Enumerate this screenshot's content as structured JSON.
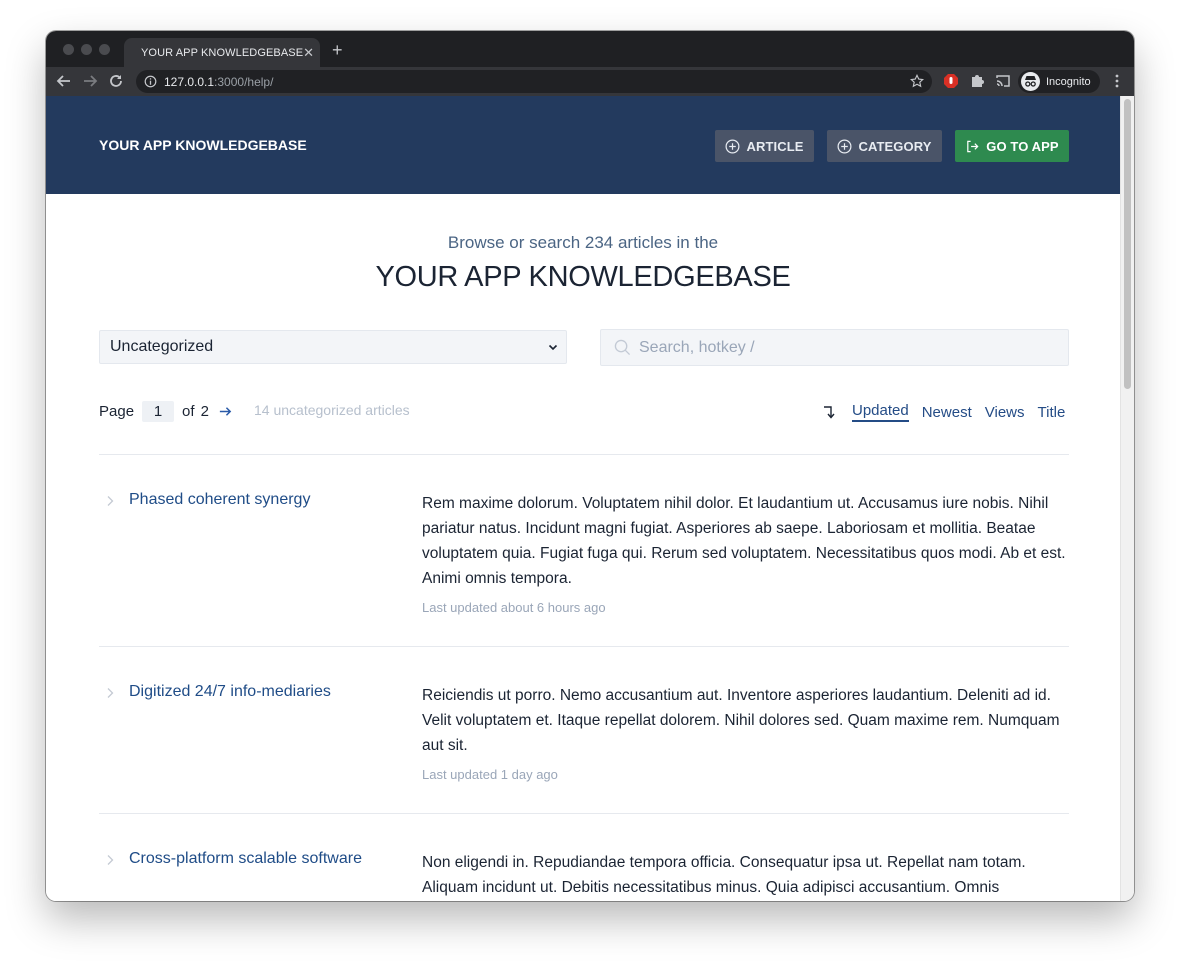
{
  "browser": {
    "tab_title": "YOUR APP KNOWLEDGEBASE",
    "url_host": "127.0.0.1",
    "url_rest": ":3000/help/",
    "profile_label": "Incognito"
  },
  "header": {
    "brand": "YOUR APP KNOWLEDGEBASE",
    "article_button": "ARTICLE",
    "category_button": "CATEGORY",
    "go_to_app_button": "GO TO APP",
    "colors": {
      "header_bg": "#233a5e",
      "gray_button": "#4a5468",
      "green_button": "#2e8a4f"
    }
  },
  "hero": {
    "subtitle": "Browse or search 234 articles in the",
    "title": "YOUR APP KNOWLEDGEBASE"
  },
  "filters": {
    "category_selected": "Uncategorized",
    "search_placeholder": "Search, hotkey /"
  },
  "pagination": {
    "page_label": "Page",
    "current_page": "1",
    "of_label": "of",
    "total_pages": "2",
    "article_count": "14 uncategorized articles"
  },
  "sort": {
    "options": [
      "Updated",
      "Newest",
      "Views",
      "Title"
    ],
    "active": "Updated"
  },
  "articles": [
    {
      "title": "Phased coherent synergy",
      "body": "Rem maxime dolorum. Voluptatem nihil dolor. Et laudantium ut. Accusamus iure nobis. Nihil pariatur natus. Incidunt magni fugiat. Asperiores ab saepe. Laboriosam et mollitia. Beatae voluptatem quia. Fugiat fuga qui. Rerum sed voluptatem. Necessitatibus quos modi. Ab et est. Animi omnis tempora.",
      "meta": "Last updated about 6 hours ago"
    },
    {
      "title": "Digitized 24/7 info-mediaries",
      "body": "Reiciendis ut porro. Nemo accusantium aut. Inventore asperiores laudantium. Deleniti ad id. Velit voluptatem et. Itaque repellat dolorem. Nihil dolores sed. Quam maxime rem. Numquam aut sit.",
      "meta": "Last updated 1 day ago"
    },
    {
      "title": "Cross-platform scalable software",
      "body": "Non eligendi in. Repudiandae tempora officia. Consequatur ipsa ut. Repellat nam totam. Aliquam incidunt ut. Debitis necessitatibus minus. Quia adipisci accusantium. Omnis",
      "meta": ""
    }
  ]
}
